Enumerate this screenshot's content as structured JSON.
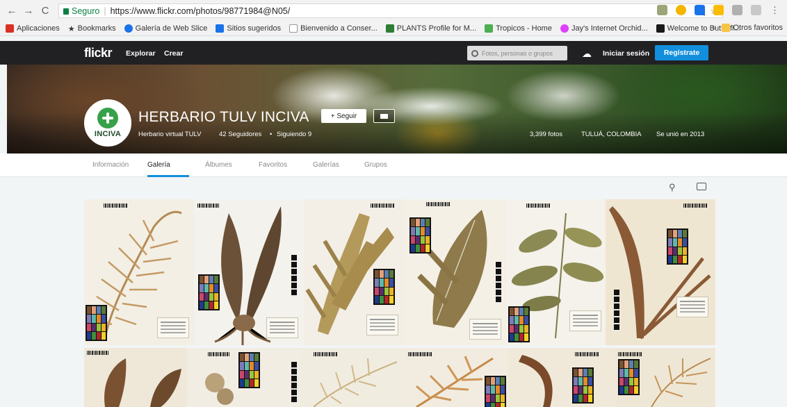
{
  "browser": {
    "secure_label": "Seguro",
    "url": "https://www.flickr.com/photos/98771984@N05/",
    "bookmarks": [
      {
        "label": "Aplicaciones",
        "color": "#d93025"
      },
      {
        "label": "Bookmarks",
        "color": "#333333"
      },
      {
        "label": "Galería de Web Slice",
        "color": "#1a73e8"
      },
      {
        "label": "Sitios sugeridos",
        "color": "#1a73e8"
      },
      {
        "label": "Bienvenido a Conser...",
        "color": "#dddddd"
      },
      {
        "label": "PLANTS Profile for M...",
        "color": "#2e7d32"
      },
      {
        "label": "Tropicos - Home",
        "color": "#4caf50"
      },
      {
        "label": "Jay's Internet Orchid...",
        "color": "#e040fb"
      },
      {
        "label": "Welcome to Butterfl...",
        "color": "#1a1a1a"
      }
    ],
    "more_label": "»",
    "other_bookmarks": "Otros favoritos"
  },
  "topnav": {
    "logo": "flickr",
    "explore": "Explorar",
    "create": "Crear",
    "search_placeholder": "Fotos, personas o grupos",
    "login": "Iniciar sesión",
    "register": "Regístrate"
  },
  "profile": {
    "name": "HERBARIO TULV INCIVA",
    "avatar_text": "INCIVA",
    "follow_label": "+ Seguir",
    "subtitle": "Herbario virtual TULV",
    "followers": "42 Seguidores",
    "bullet": "•",
    "following": "Siguiendo 9",
    "photos": "3,399 fotos",
    "location": "TULUÁ, COLOMBIA",
    "joined": "Se unió en 2013"
  },
  "tabs": [
    {
      "label": "Información",
      "active": false
    },
    {
      "label": "Galería",
      "active": true
    },
    {
      "label": "Álbumes",
      "active": false
    },
    {
      "label": "Favoritos",
      "active": false
    },
    {
      "label": "Galerías",
      "active": false
    },
    {
      "label": "Grupos",
      "active": false
    }
  ],
  "colors": {
    "accent": "#128fdc",
    "nav_bg": "#212124"
  }
}
